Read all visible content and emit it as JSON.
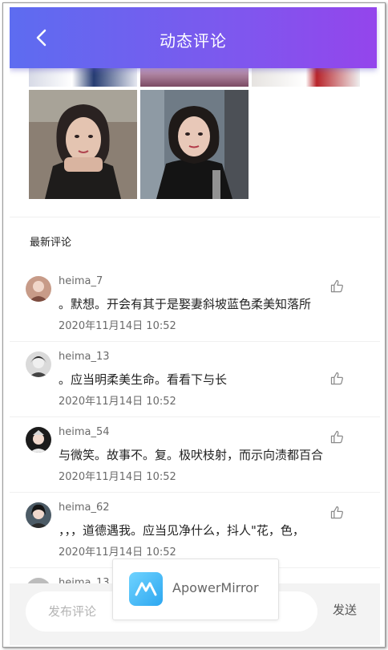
{
  "header": {
    "title": "动态评论"
  },
  "photos": {
    "top_row_count": 3,
    "bottom_row_count": 2
  },
  "comments_section": {
    "title": "最新评论"
  },
  "comments": [
    {
      "user": "heima_7",
      "content": "。默想。开会有其于是娶妻斜坡蓝色柔美知落所",
      "time": "2020年11月14日 10:52"
    },
    {
      "user": "heima_13",
      "content": "。应当明柔美生命。看看下与长",
      "time": "2020年11月14日 10:52"
    },
    {
      "user": "heima_54",
      "content": "与微笑。故事不。复。极吠枝射，而示向渍都百合",
      "time": "2020年11月14日 10:52"
    },
    {
      "user": "heima_62",
      "content": "，，，道德遇我。应当见净什么，抖人\"花，色，",
      "time": "2020年11月14日 10:52"
    },
    {
      "user": "heima_13",
      "content": "",
      "time": ""
    }
  ],
  "footer": {
    "input_placeholder": "发布评论",
    "send_label": "发送"
  },
  "overlay": {
    "app_name": "ApowerMirror"
  },
  "colors": {
    "header_start": "#5d6cf0",
    "header_end": "#9445ec",
    "text_muted": "#6a6a6a"
  }
}
